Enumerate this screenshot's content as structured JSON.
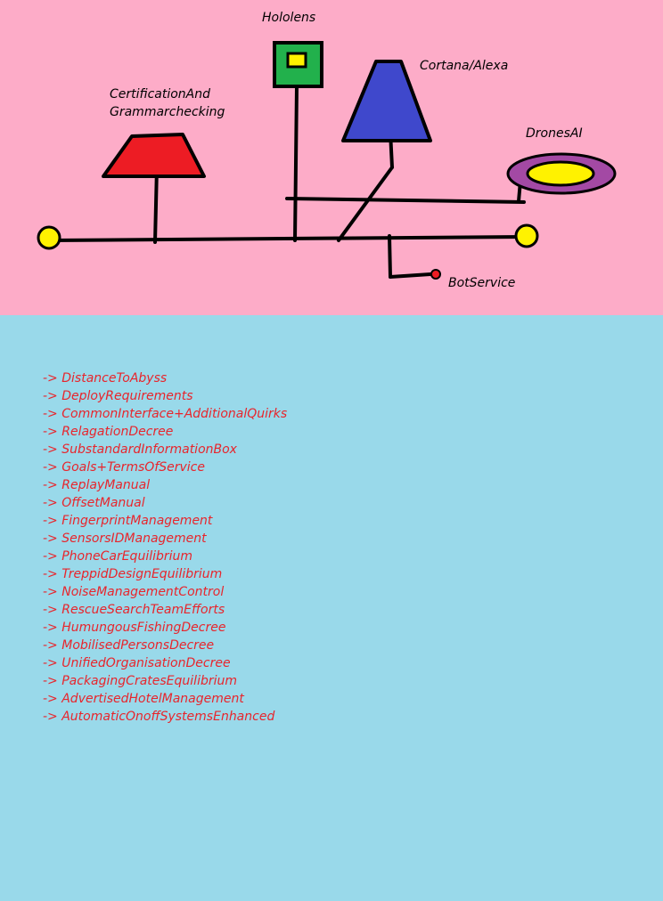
{
  "diagram": {
    "labels": {
      "hololens": "Hololens",
      "cortana": "Cortana/Alexa",
      "certification": "CertificationAnd\nGrammarchecking",
      "drones": "DronesAI",
      "botservice": "BotService"
    },
    "colors": {
      "top_background": "#fdacc8",
      "bottom_background": "#99d9ea",
      "red_trapezoid": "#ed1c24",
      "blue_trapezoid": "#3f48cc",
      "green_square": "#22b14c",
      "yellow": "#fff200",
      "purple": "#a349a4",
      "list_text": "#e8252c"
    }
  },
  "list": {
    "prefix": "->",
    "items": [
      "DistanceToAbyss",
      "DeployRequirements",
      "CommonInterface+AdditionalQuirks",
      "RelagationDecree",
      "SubstandardInformationBox",
      "Goals+TermsOfService",
      "ReplayManual",
      "OffsetManual",
      "FingerprintManagement",
      "SensorsIDManagement",
      "PhoneCarEquilibrium",
      "TreppidDesignEquilibrium",
      "NoiseManagementControl",
      "RescueSearchTeamEfforts",
      "HumungousFishingDecree",
      "MobilisedPersonsDecree",
      "UnifiedOrganisationDecree",
      "PackagingCratesEquilibrium",
      "AdvertisedHotelManagement",
      "AutomaticOnoffSystemsEnhanced"
    ]
  }
}
